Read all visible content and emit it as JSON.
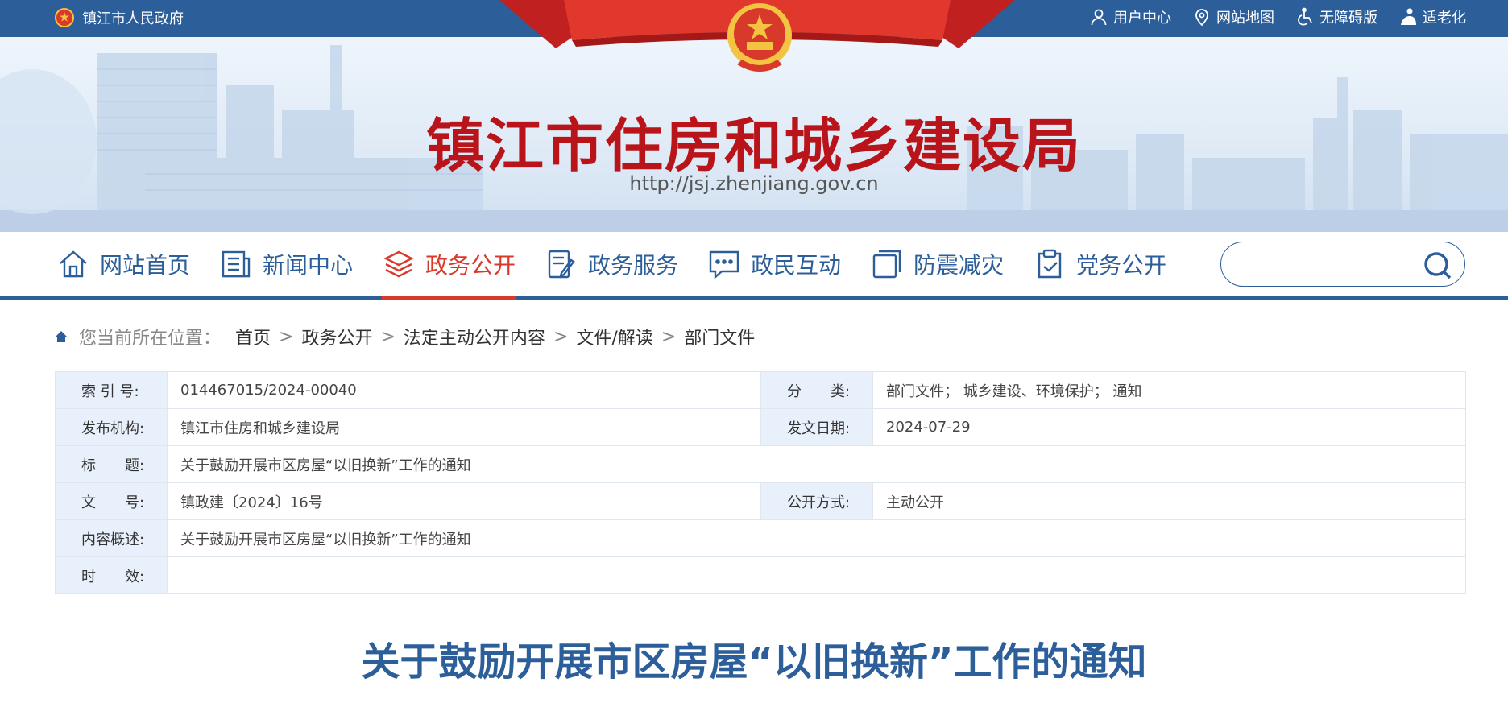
{
  "topbar": {
    "gov_name": "镇江市人民政府",
    "links": [
      {
        "label": "用户中心",
        "icon": "user-icon"
      },
      {
        "label": "网站地图",
        "icon": "map-pin-icon"
      },
      {
        "label": "无障碍版",
        "icon": "accessibility-icon"
      },
      {
        "label": "适老化",
        "icon": "elderly-icon"
      }
    ]
  },
  "banner": {
    "title": "镇江市住房和城乡建设局",
    "url": "http://jsj.zhenjiang.gov.cn"
  },
  "nav": {
    "items": [
      {
        "label": "网站首页",
        "icon": "home-icon"
      },
      {
        "label": "新闻中心",
        "icon": "news-icon"
      },
      {
        "label": "政务公开",
        "icon": "layers-icon"
      },
      {
        "label": "政务服务",
        "icon": "form-edit-icon"
      },
      {
        "label": "政民互动",
        "icon": "chat-icon"
      },
      {
        "label": "防震减灾",
        "icon": "square-icon"
      },
      {
        "label": "党务公开",
        "icon": "clipboard-icon"
      }
    ],
    "active": "政务公开",
    "search_placeholder": ""
  },
  "breadcrumb": {
    "label": "您当前所在位置：",
    "items": [
      "首页",
      "政务公开",
      "法定主动公开内容",
      "文件/解读",
      "部门文件"
    ],
    "separator": ">"
  },
  "meta": {
    "index_label": "索 引 号:",
    "index_value": "014467015/2024-00040",
    "category_label": "分　　类:",
    "category_value": "部门文件；  城乡建设、环境保护；  通知",
    "publisher_label": "发布机构:",
    "publisher_value": "镇江市住房和城乡建设局",
    "date_label": "发文日期:",
    "date_value": "2024-07-29",
    "title_label": "标　　题:",
    "title_value": "关于鼓励开展市区房屋“以旧换新”工作的通知",
    "docno_label": "文　　号:",
    "docno_value": "镇政建〔2024〕16号",
    "mode_label": "公开方式:",
    "mode_value": "主动公开",
    "summary_label": "内容概述:",
    "summary_value": "关于鼓励开展市区房屋“以旧换新”工作的通知",
    "validity_label": "时　　效:",
    "validity_value": ""
  },
  "document": {
    "title": "关于鼓励开展市区房屋“以旧换新”工作的通知"
  }
}
